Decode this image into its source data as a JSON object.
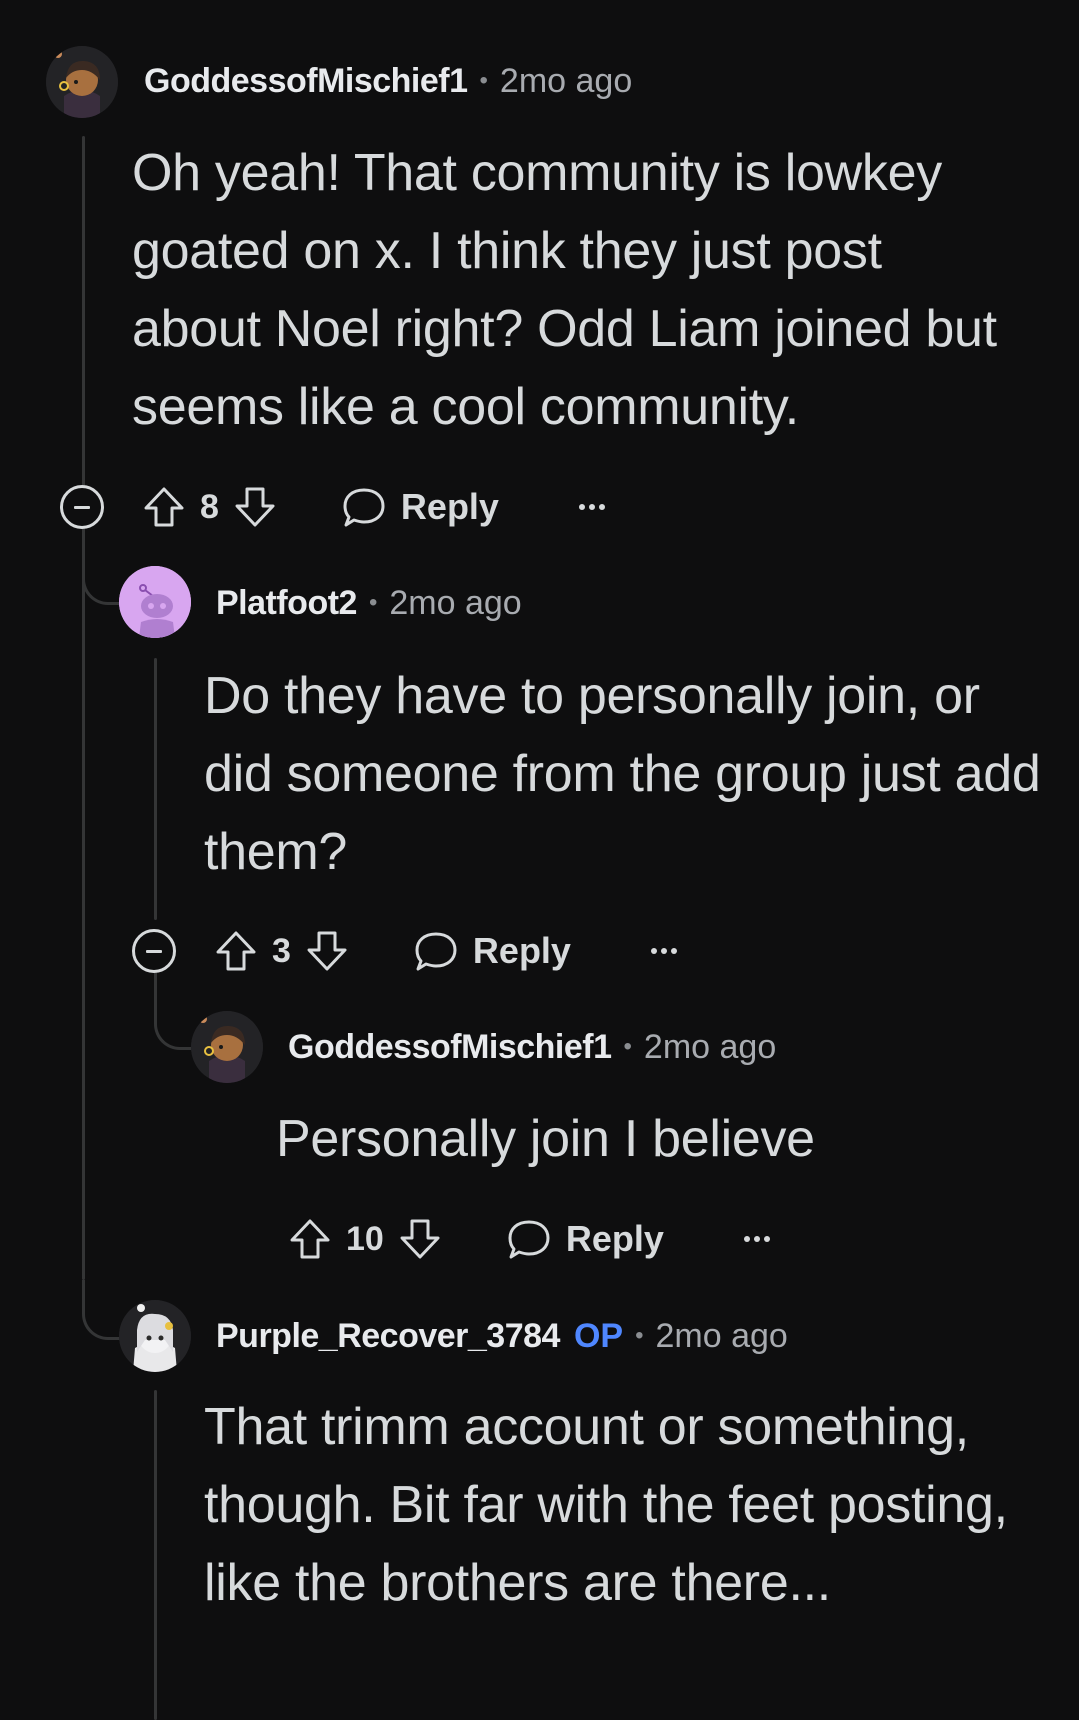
{
  "comments": [
    {
      "username": "GoddessofMischief1",
      "time": "2mo ago",
      "body": "Oh yeah! That community is lowkey goated on x. I think they just post about Noel right? Odd Liam joined but seems like a cool community.",
      "votes": "8",
      "reply_label": "Reply"
    },
    {
      "username": "Platfoot2",
      "time": "2mo ago",
      "body": "Do they have to personally join, or did someone from the group just add them?",
      "votes": "3",
      "reply_label": "Reply"
    },
    {
      "username": "GoddessofMischief1",
      "time": "2mo ago",
      "body": "Personally join I believe",
      "votes": "10",
      "reply_label": "Reply"
    },
    {
      "username": "Purple_Recover_3784",
      "op_tag": "OP",
      "time": "2mo ago",
      "body": "That trimm account or something, though. Bit far with the feet posting, like the brothers are there..."
    }
  ],
  "separator": "•",
  "icons": {
    "upvote": "upvote-arrow-icon",
    "downvote": "downvote-arrow-icon",
    "reply": "speech-bubble-icon",
    "more": "ellipsis-icon",
    "collapse": "collapse-minus-icon"
  },
  "colors": {
    "background": "#0e0e0f",
    "text": "#d7dadc",
    "meta": "#a8abb0",
    "op": "#4f87ff",
    "thread_line": "#343536"
  }
}
